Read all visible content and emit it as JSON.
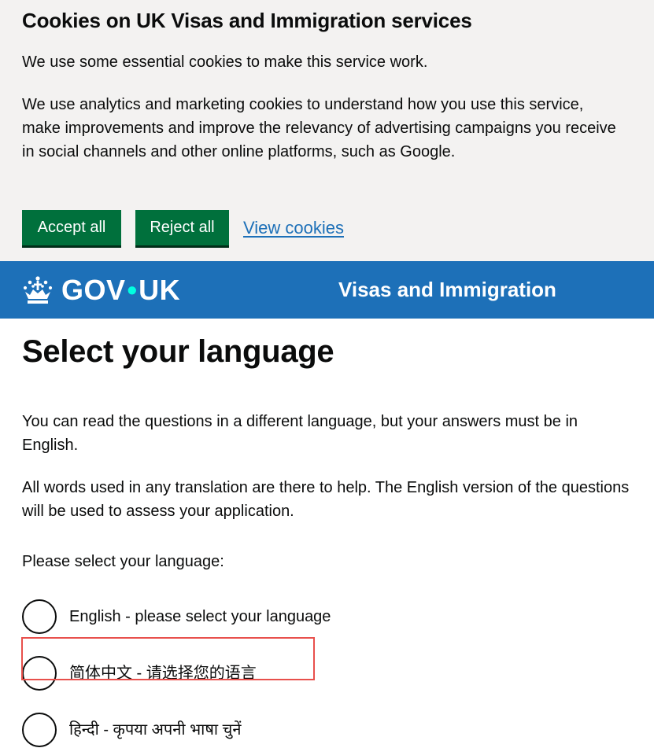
{
  "cookie_banner": {
    "title": "Cookies on UK Visas and Immigration services",
    "paragraph1": "We use some essential cookies to make this service work.",
    "paragraph2": "We use analytics and marketing cookies to understand how you use this service, make improvements and improve the relevancy of advertising campaigns you receive in social channels and other online platforms, such as Google.",
    "accept_label": "Accept all",
    "reject_label": "Reject all",
    "view_label": "View cookies"
  },
  "header": {
    "logo_gov": "GOV",
    "logo_dot": "•",
    "logo_uk": "UK",
    "service_name": "Visas and Immigration"
  },
  "main": {
    "title": "Select your language",
    "intro1": "You can read the questions in a different language, but your answers must be in English.",
    "intro2": "All words used in any translation are there to help. The English version of the questions will be used to assess your application.",
    "prompt": "Please select your language:",
    "options": [
      {
        "label": "English - please select your language"
      },
      {
        "label": "简体中文 - 请选择您的语言"
      },
      {
        "label": "हिन्दी - कृपया अपनी भाषा चुनें"
      }
    ]
  },
  "colors": {
    "banner_bg": "#f3f2f1",
    "button_green": "#00703c",
    "header_blue": "#1d70b8",
    "link_blue": "#1d70b8",
    "highlight_red": "#e8504c"
  }
}
